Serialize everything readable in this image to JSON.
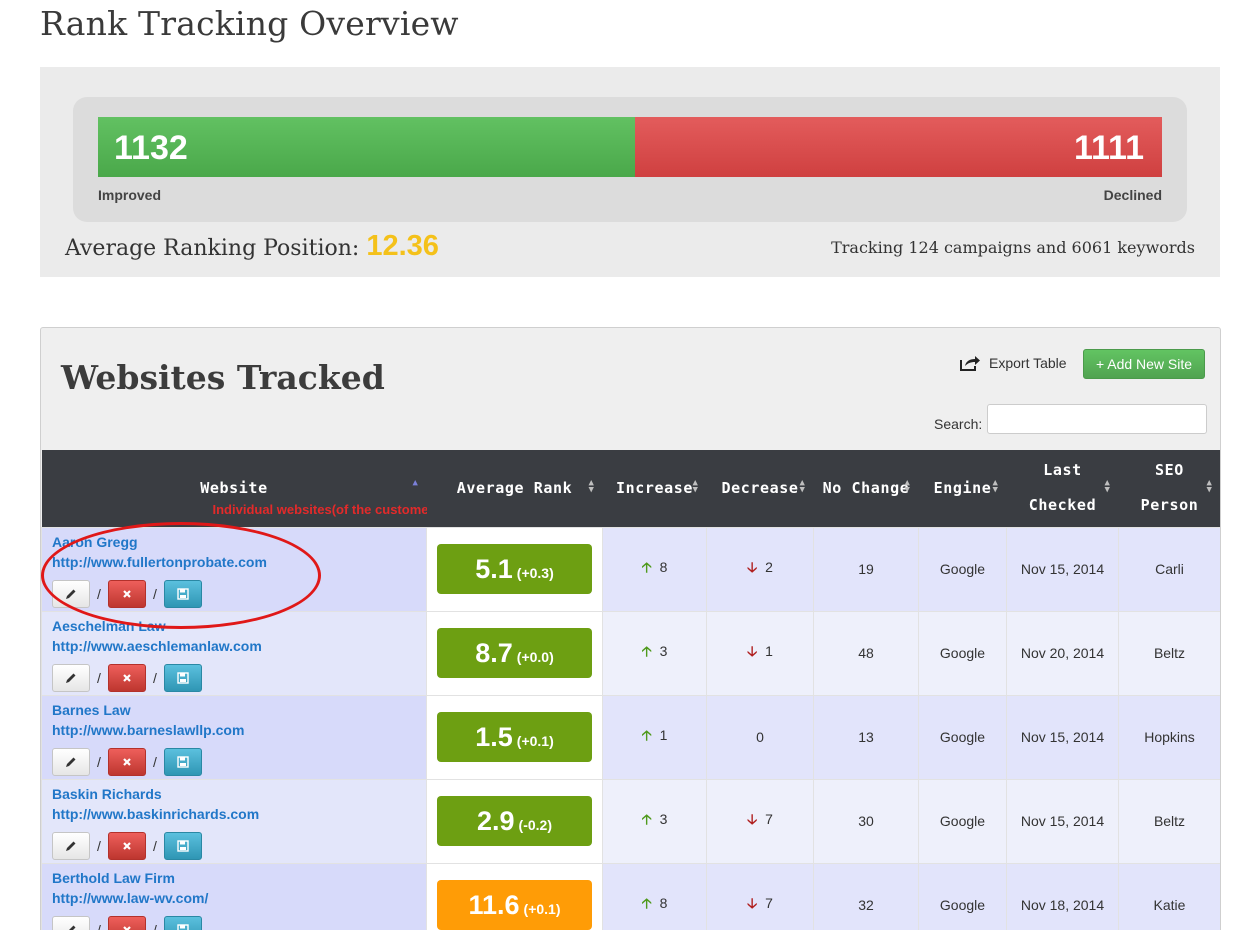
{
  "page_title": "Rank Tracking Overview",
  "overview": {
    "improved_count": "1132",
    "declined_count": "1111",
    "improved_label": "Improved",
    "declined_label": "Declined",
    "avg_rank_label": "Average Ranking Position:",
    "avg_rank_value": "12.36",
    "tracking_text": "Tracking 124 campaigns and 6061 keywords",
    "colors": {
      "improved": "#5cb85c",
      "declined": "#d9534f",
      "avg_value": "#f4c11a"
    }
  },
  "websites": {
    "title": "Websites Tracked",
    "export_label": "Export Table",
    "add_site_label": "+ Add New Site",
    "search_label": "Search:",
    "search_value": "",
    "annotation": "Individual websites(of the customer)",
    "headers": {
      "website": "Website",
      "avg_rank": "Average Rank",
      "increase": "Increase",
      "decrease": "Decrease",
      "no_change": "No Change",
      "engine": "Engine",
      "last_checked": "Last Checked",
      "seo_person": "SEO Person"
    },
    "rows": [
      {
        "name": "Aaron Gregg",
        "url": "http://www.fullertonprobate.com",
        "rank": "5.1",
        "delta": "(+0.3)",
        "rank_color": "green",
        "increase": "8",
        "decrease": "2",
        "no_change": "19",
        "engine": "Google",
        "last_checked": "Nov 15, 2014",
        "seo_person": "Carli"
      },
      {
        "name": "Aeschelman Law",
        "url": "http://www.aeschlemanlaw.com",
        "rank": "8.7",
        "delta": "(+0.0)",
        "rank_color": "green",
        "increase": "3",
        "decrease": "1",
        "no_change": "48",
        "engine": "Google",
        "last_checked": "Nov 20, 2014",
        "seo_person": "Beltz"
      },
      {
        "name": "Barnes Law",
        "url": "http://www.barneslawllp.com",
        "rank": "1.5",
        "delta": "(+0.1)",
        "rank_color": "green",
        "increase": "1",
        "decrease": "0",
        "no_change": "13",
        "engine": "Google",
        "last_checked": "Nov 15, 2014",
        "seo_person": "Hopkins"
      },
      {
        "name": "Baskin Richards",
        "url": "http://www.baskinrichards.com",
        "rank": "2.9",
        "delta": "(-0.2)",
        "rank_color": "green",
        "increase": "3",
        "decrease": "7",
        "no_change": "30",
        "engine": "Google",
        "last_checked": "Nov 15, 2014",
        "seo_person": "Beltz"
      },
      {
        "name": "Berthold Law Firm",
        "url": "http://www.law-wv.com/",
        "rank": "11.6",
        "delta": "(+0.1)",
        "rank_color": "orange",
        "increase": "8",
        "decrease": "7",
        "no_change": "32",
        "engine": "Google",
        "last_checked": "Nov 18, 2014",
        "seo_person": "Katie"
      }
    ]
  }
}
